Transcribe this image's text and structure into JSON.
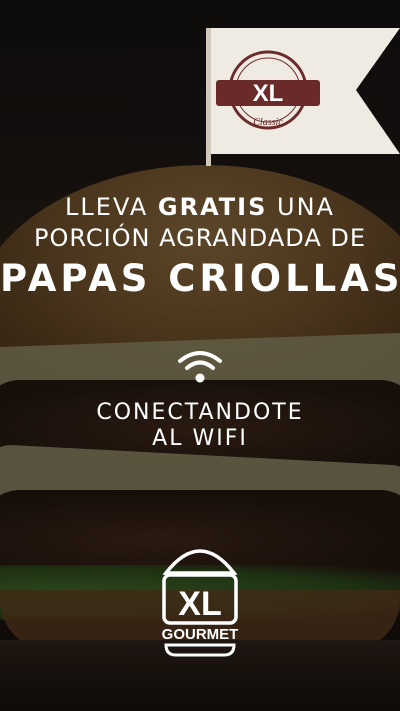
{
  "promo": {
    "line1_pre": "LLEVA ",
    "line1_bold": "GRATIS",
    "line1_post": " UNA",
    "line2": "PORCIÓN AGRANDADA DE",
    "line3": "PAPAS CRIOLLAS"
  },
  "connect": {
    "line1": "CONECTANDOTE",
    "line2": "AL WIFI"
  },
  "flag": {
    "brand": "XL",
    "tagline": "Classic"
  },
  "logo": {
    "brand": "XL",
    "sub": "GOURMET"
  },
  "icons": {
    "wifi": "wifi-icon",
    "logo": "burger-logo-icon"
  },
  "colors": {
    "text": "#ffffff",
    "flag_bg": "#f2efe8",
    "flag_badge": "#6b2a2a"
  }
}
